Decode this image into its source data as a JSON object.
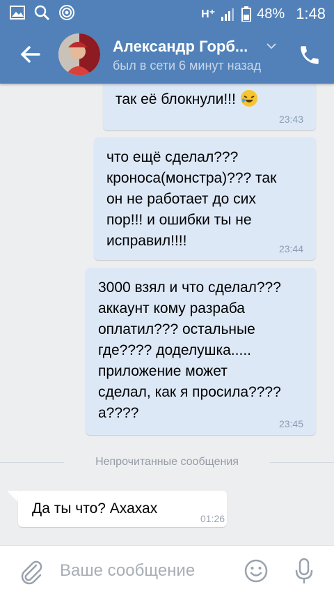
{
  "status_bar": {
    "network": "H⁺",
    "battery": "48%",
    "time": "1:48"
  },
  "header": {
    "contact_name": "Александр Горб...",
    "presence": "был в сети 6 минут назад"
  },
  "messages": [
    {
      "text": "так её блокнули!!!",
      "time": "23:43",
      "emoji": "rofl-emoji"
    },
    {
      "text": "что ещё сделал???\nкроноса(монстра)??? так\nон не работает до сих\nпор!!! и ошибки ты не\nисправил!!!!",
      "time": "23:44"
    },
    {
      "text": "3000 взял и что сделал???\nаккаунт кому разраба\nоплатил??? остальные\nгде???? доделушка.....\nприложение может\nсделал, как я просила????\nа????",
      "time": "23:45"
    }
  ],
  "unread_divider": "Непрочитанные сообщения",
  "incoming": {
    "text": "Да ты что? Ахахах",
    "time": "01:26"
  },
  "composer": {
    "placeholder": "Ваше сообщение"
  },
  "colors": {
    "header": "#5181b8",
    "outgoing_bubble": "#dde8f7",
    "background": "#edeef0"
  }
}
